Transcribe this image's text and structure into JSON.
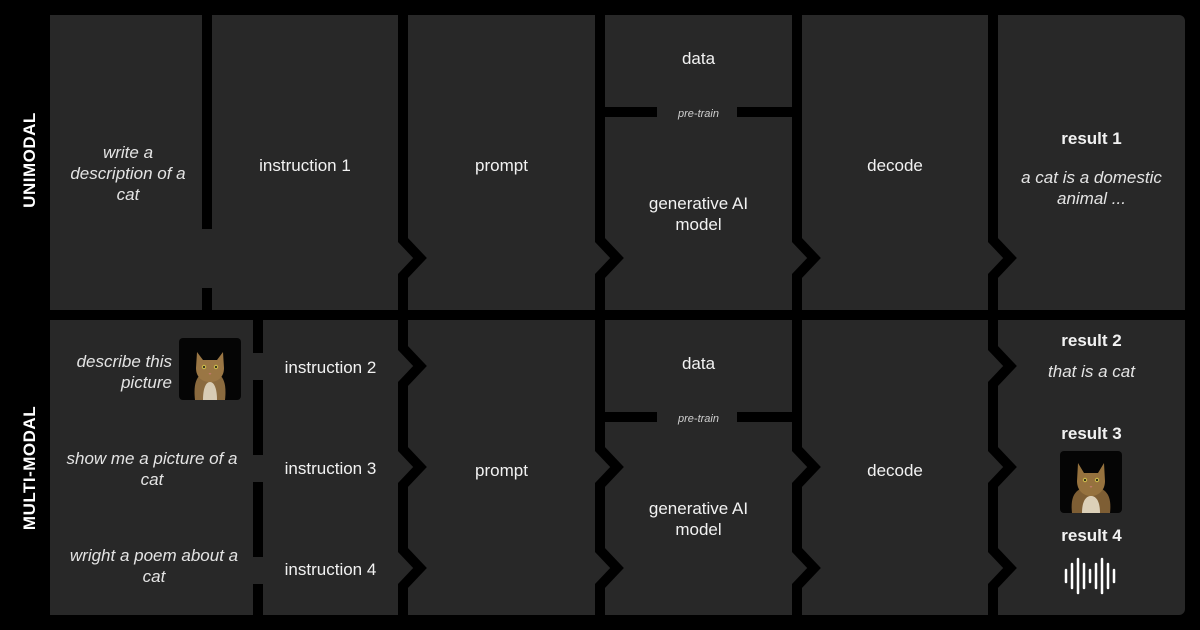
{
  "rows": {
    "unimodal": {
      "label": "UNIMODAL",
      "input": "write a description  of a cat",
      "instruction": "instruction 1",
      "prompt": "prompt",
      "data": "data",
      "pretrain": "pre-train",
      "model": "generative AI model",
      "decode": "decode",
      "result_title": "result 1",
      "result_text": "a cat is a domestic animal ..."
    },
    "multimodal": {
      "label": "MULTI-MODAL",
      "inputs": [
        "describe this picture",
        "show me a picture of a cat",
        "wright a poem about a cat"
      ],
      "instructions": [
        "instruction 2",
        "instruction 3",
        "instruction 4"
      ],
      "prompt": "prompt",
      "data": "data",
      "pretrain": "pre-train",
      "model": "generative AI model",
      "decode": "decode",
      "results": [
        {
          "title": "result 2",
          "text": "that is a cat"
        },
        {
          "title": "result 3",
          "content": "cat-image"
        },
        {
          "title": "result 4",
          "content": "audio-waveform-icon"
        }
      ]
    }
  },
  "colors": {
    "background": "#000000",
    "panel": "#282828",
    "text": "#f2f2f2"
  }
}
